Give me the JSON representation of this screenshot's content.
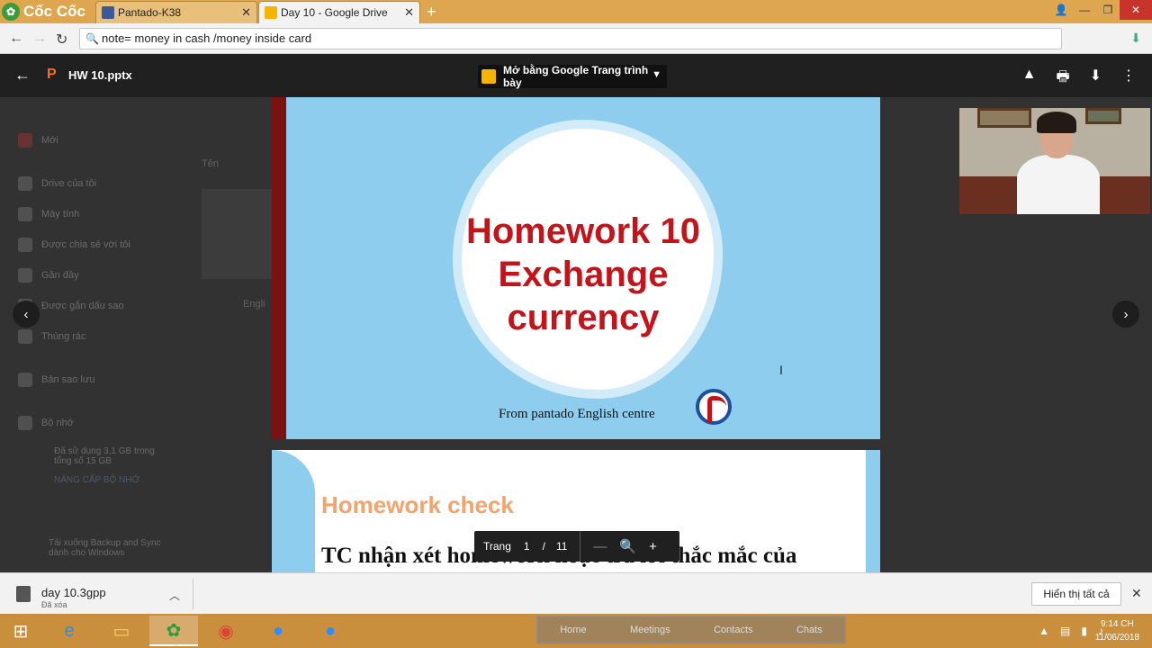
{
  "browser": {
    "brand": "Cốc Cốc",
    "tabs": [
      {
        "label": "Pantado-K38",
        "favicon": "facebook-icon",
        "color": "#3b5998"
      },
      {
        "label": "Day 10 - Google Drive",
        "favicon": "google-drive-icon",
        "color": "#f4b400"
      }
    ],
    "address": "note= money in cash /money inside card"
  },
  "viewer": {
    "filename": "HW 10.pptx",
    "open_with": "Mở bằng Google Trang trình bày"
  },
  "drive_backdrop": {
    "new_button": "Mới",
    "items": [
      "Drive của tôi",
      "Máy tính",
      "Được chia sẻ với tôi",
      "Gần đây",
      "Được gắn dấu sao",
      "Thùng rác",
      "Bản sao lưu",
      "Bộ nhớ"
    ],
    "storage_note": "Đã sử dụng 3,1 GB trong tổng số 15 GB",
    "upgrade": "NÂNG CẤP BỘ NHỚ",
    "backup_note": "Tải xuống Backup and Sync dành cho Windows",
    "column_name": "Tên",
    "file_label": "Engli"
  },
  "slide1": {
    "title_line1": "Homework 10",
    "title_line2": "Exchange",
    "title_line3": "currency",
    "from": "From pantado English centre"
  },
  "slide2": {
    "title": "Homework check",
    "text": "TC nhận xét homework hoặc trả lời thắc mắc của"
  },
  "pager": {
    "label": "Trang",
    "current": "1",
    "separator": "/",
    "total": "11"
  },
  "download": {
    "filename": "day 10.3gpp",
    "status": "Đã xóa",
    "show_all": "Hiển thị tất cả"
  },
  "taskbar": {
    "zoom_tabs": [
      "Home",
      "Meetings",
      "Contacts",
      "Chats"
    ],
    "time": "9:14 CH",
    "date": "11/06/2018"
  }
}
